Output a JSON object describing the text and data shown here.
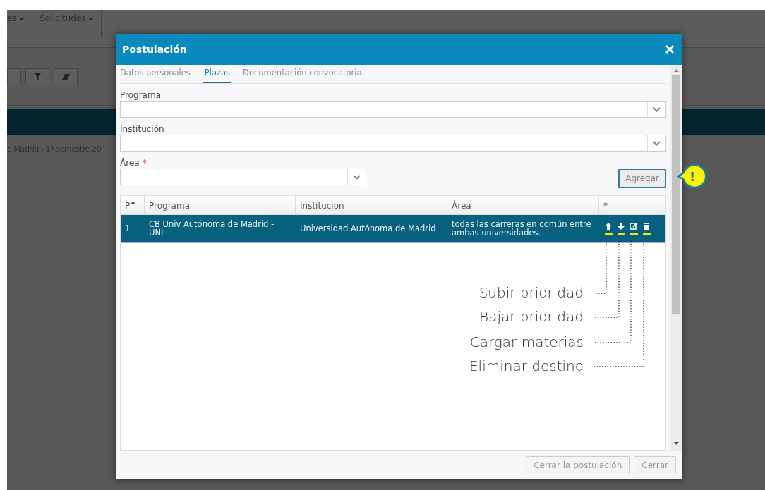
{
  "background_page": {
    "menus": [
      {
        "label": "es"
      },
      {
        "label": "Solicitudes"
      }
    ],
    "breadcrumb": "e Madrid - 1º semestre 20"
  },
  "modal": {
    "title": "Postulación",
    "tabs": [
      {
        "label": "Datos personales",
        "selected": false
      },
      {
        "label": "Plazas",
        "selected": true
      },
      {
        "label": "Documentación convocatoria",
        "selected": false
      }
    ],
    "fields": [
      {
        "label": "Programa",
        "required": false
      },
      {
        "label": "Institución",
        "required": false
      }
    ],
    "area_field": {
      "label": "Área",
      "required": true
    },
    "add_button": {
      "label": "Agregar"
    },
    "callout": {
      "text": "!"
    },
    "table": {
      "columns": [
        {
          "label": "P",
          "sorted": true
        },
        {
          "label": "Programa",
          "sorted": false
        },
        {
          "label": "Institucion",
          "sorted": false
        },
        {
          "label": "Área",
          "sorted": false
        },
        {
          "label": "*",
          "sorted": false
        }
      ],
      "rows": [
        {
          "selected": true,
          "cells": [
            "1",
            "CB Univ Autónoma de Madrid - UNL",
            "Universidad Autónoma de Madrid",
            "todas las carreras en común entre ambas universidades."
          ],
          "actions": [
            {
              "kind": "up"
            },
            {
              "kind": "down"
            },
            {
              "kind": "edit"
            },
            {
              "kind": "delete"
            }
          ]
        }
      ]
    },
    "annotations": [
      {
        "label": "Subir prioridad"
      },
      {
        "label": "Bajar prioridad"
      },
      {
        "label": "Cargar materias"
      },
      {
        "label": "Eliminar destino"
      }
    ],
    "footer_buttons": [
      {
        "label": "Cerrar la postulación"
      },
      {
        "label": "Cerrar"
      }
    ]
  }
}
